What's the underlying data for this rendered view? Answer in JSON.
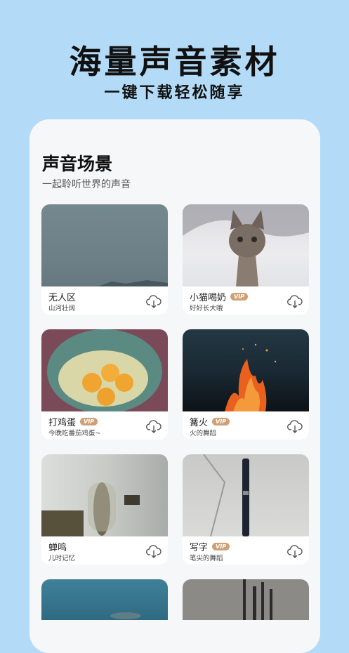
{
  "hero": {
    "title": "海量声音素材",
    "subtitle": "一键下载轻松随享"
  },
  "section": {
    "title": "声音场景",
    "subtitle": "一起聆听世界的声音"
  },
  "vip_label": "VIP",
  "cards": [
    {
      "title": "无人区",
      "subtitle": "山河壮阔",
      "vip": false,
      "icon": "download-cloud-icon"
    },
    {
      "title": "小猫喝奶",
      "subtitle": "好好长大哦",
      "vip": true,
      "icon": "download-cloud-icon"
    },
    {
      "title": "打鸡蛋",
      "subtitle": "今晚吃番茄鸡蛋~",
      "vip": true,
      "icon": "download-cloud-icon"
    },
    {
      "title": "篝火",
      "subtitle": "火的舞蹈",
      "vip": true,
      "icon": "download-cloud-icon"
    },
    {
      "title": "蝉鸣",
      "subtitle": "儿时记忆",
      "vip": false,
      "icon": "download-cloud-icon"
    },
    {
      "title": "写字",
      "subtitle": "笔尖的舞蹈",
      "vip": true,
      "icon": "download-cloud-icon"
    }
  ],
  "colors": {
    "background": "#b3dbf8",
    "panel": "#f6f7f9",
    "vip_badge": "#cfa074"
  }
}
